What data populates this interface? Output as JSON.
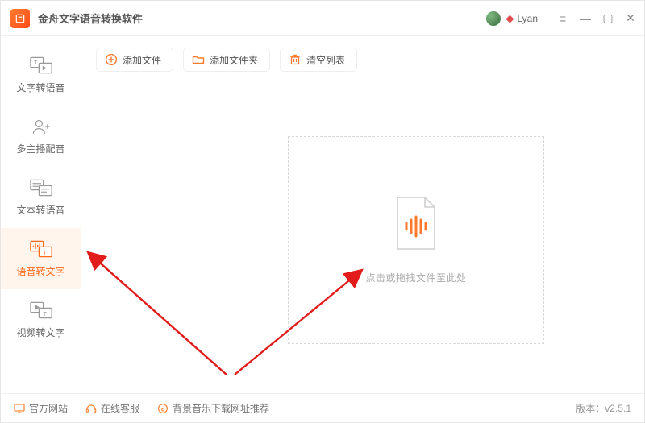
{
  "titlebar": {
    "app_title": "金舟文字语音转换软件",
    "user_name": "Lyan"
  },
  "sidebar": {
    "items": [
      {
        "label": "文字转语音"
      },
      {
        "label": "多主播配音"
      },
      {
        "label": "文本转语音"
      },
      {
        "label": "语音转文字"
      },
      {
        "label": "视频转文字"
      }
    ]
  },
  "toolbar": {
    "add_file": "添加文件",
    "add_folder": "添加文件夹",
    "clear_list": "清空列表"
  },
  "drop": {
    "hint": "点击或拖拽文件至此处"
  },
  "footer": {
    "official_site": "官方网站",
    "online_service": "在线客服",
    "bgm_recommend": "背景音乐下载网址推荐",
    "version_label": "版本：",
    "version_value": "v2.5.1"
  }
}
